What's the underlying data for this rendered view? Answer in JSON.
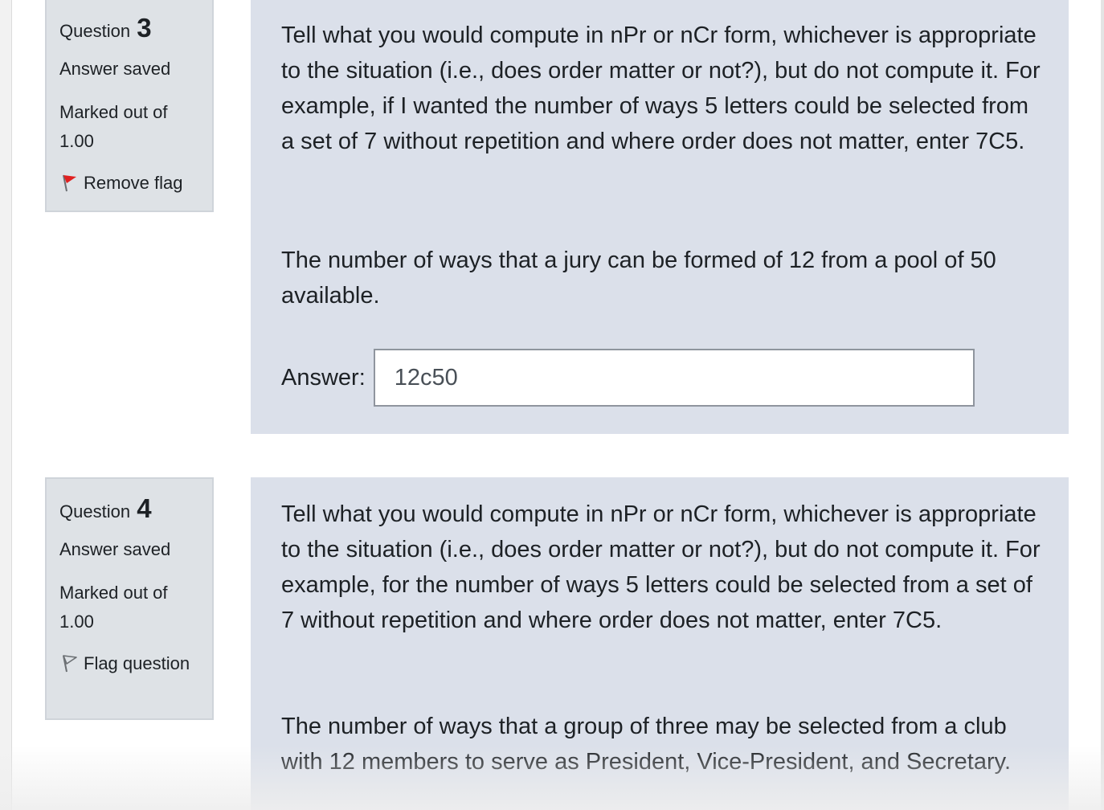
{
  "questions": [
    {
      "label": "Question",
      "number": "3",
      "state": "Answer saved",
      "grade": "Marked out of 1.00",
      "flag_label": "Remove flag",
      "flag_icon": "flag-red-icon",
      "text_intro": "Tell what you would compute in nPr or nCr form, whichever is appropriate to the situation (i.e., does order matter or not?), but do not compute it. For example, if I wanted the number of ways 5 letters could be selected from a set of 7 without repetition and where order does not matter, enter 7C5.",
      "text_question": "The number of ways that a jury can be formed of 12 from a pool of 50 available.",
      "answer_label": "Answer:",
      "answer_value": "12c50"
    },
    {
      "label": "Question",
      "number": "4",
      "state": "Answer saved",
      "grade": "Marked out of 1.00",
      "flag_label": "Flag question",
      "flag_icon": "flag-outline-icon",
      "text_intro": "Tell what you would compute in nPr or nCr form, whichever is appropriate to the situation (i.e., does order matter or not?), but do not compute it. For example, for the number of ways 5 letters could be selected from a set of 7 without repetition and where order does not matter, enter 7C5.",
      "text_question": "The number of ways that a group of three may be selected from a club with 12 members to serve as President, Vice-President, and Secretary."
    }
  ],
  "colors": {
    "info_bg": "#dee2e6",
    "content_bg": "#dbe0ea",
    "flag_red": "#e02020"
  }
}
